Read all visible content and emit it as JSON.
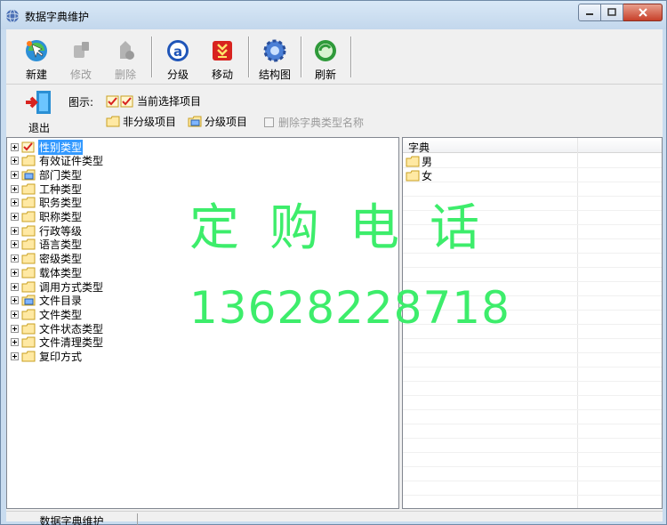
{
  "window": {
    "title": "数据字典维护"
  },
  "toolbar": {
    "new_label": "新建",
    "edit_label": "修改",
    "delete_label": "删除",
    "level_label": "分级",
    "move_label": "移动",
    "structure_label": "结构图",
    "refresh_label": "刷新",
    "exit_label": "退出"
  },
  "legend": {
    "title": "图示:",
    "selected_label": "当前选择项目",
    "non_level_label": "非分级项目",
    "level_label": "分级项目",
    "delete_type_name_label": "删除字典类型名称"
  },
  "tree": {
    "items": [
      {
        "label": "性别类型",
        "icon": "check-folder-icon",
        "selected": true
      },
      {
        "label": "有效证件类型",
        "icon": "folder-icon"
      },
      {
        "label": "部门类型",
        "icon": "level-folder-icon"
      },
      {
        "label": "工种类型",
        "icon": "folder-icon"
      },
      {
        "label": "职务类型",
        "icon": "folder-icon"
      },
      {
        "label": "职称类型",
        "icon": "folder-icon"
      },
      {
        "label": "行政等级",
        "icon": "folder-icon"
      },
      {
        "label": "语言类型",
        "icon": "folder-icon"
      },
      {
        "label": "密级类型",
        "icon": "folder-icon"
      },
      {
        "label": "载体类型",
        "icon": "folder-icon"
      },
      {
        "label": "调用方式类型",
        "icon": "folder-icon"
      },
      {
        "label": "文件目录",
        "icon": "level-folder-icon"
      },
      {
        "label": "文件类型",
        "icon": "folder-icon"
      },
      {
        "label": "文件状态类型",
        "icon": "folder-icon"
      },
      {
        "label": "文件清理类型",
        "icon": "folder-icon"
      },
      {
        "label": "复印方式",
        "icon": "folder-icon"
      }
    ]
  },
  "list": {
    "header": "字典",
    "rows": [
      "男",
      "女"
    ]
  },
  "watermark": {
    "line1": "定购电话",
    "line2": "13628228718"
  },
  "status": {
    "text": "数据字典维护"
  },
  "colors": {
    "watermark": "#3ded6b",
    "selection": "#3399ff",
    "window_frame": "#c9dcef"
  }
}
